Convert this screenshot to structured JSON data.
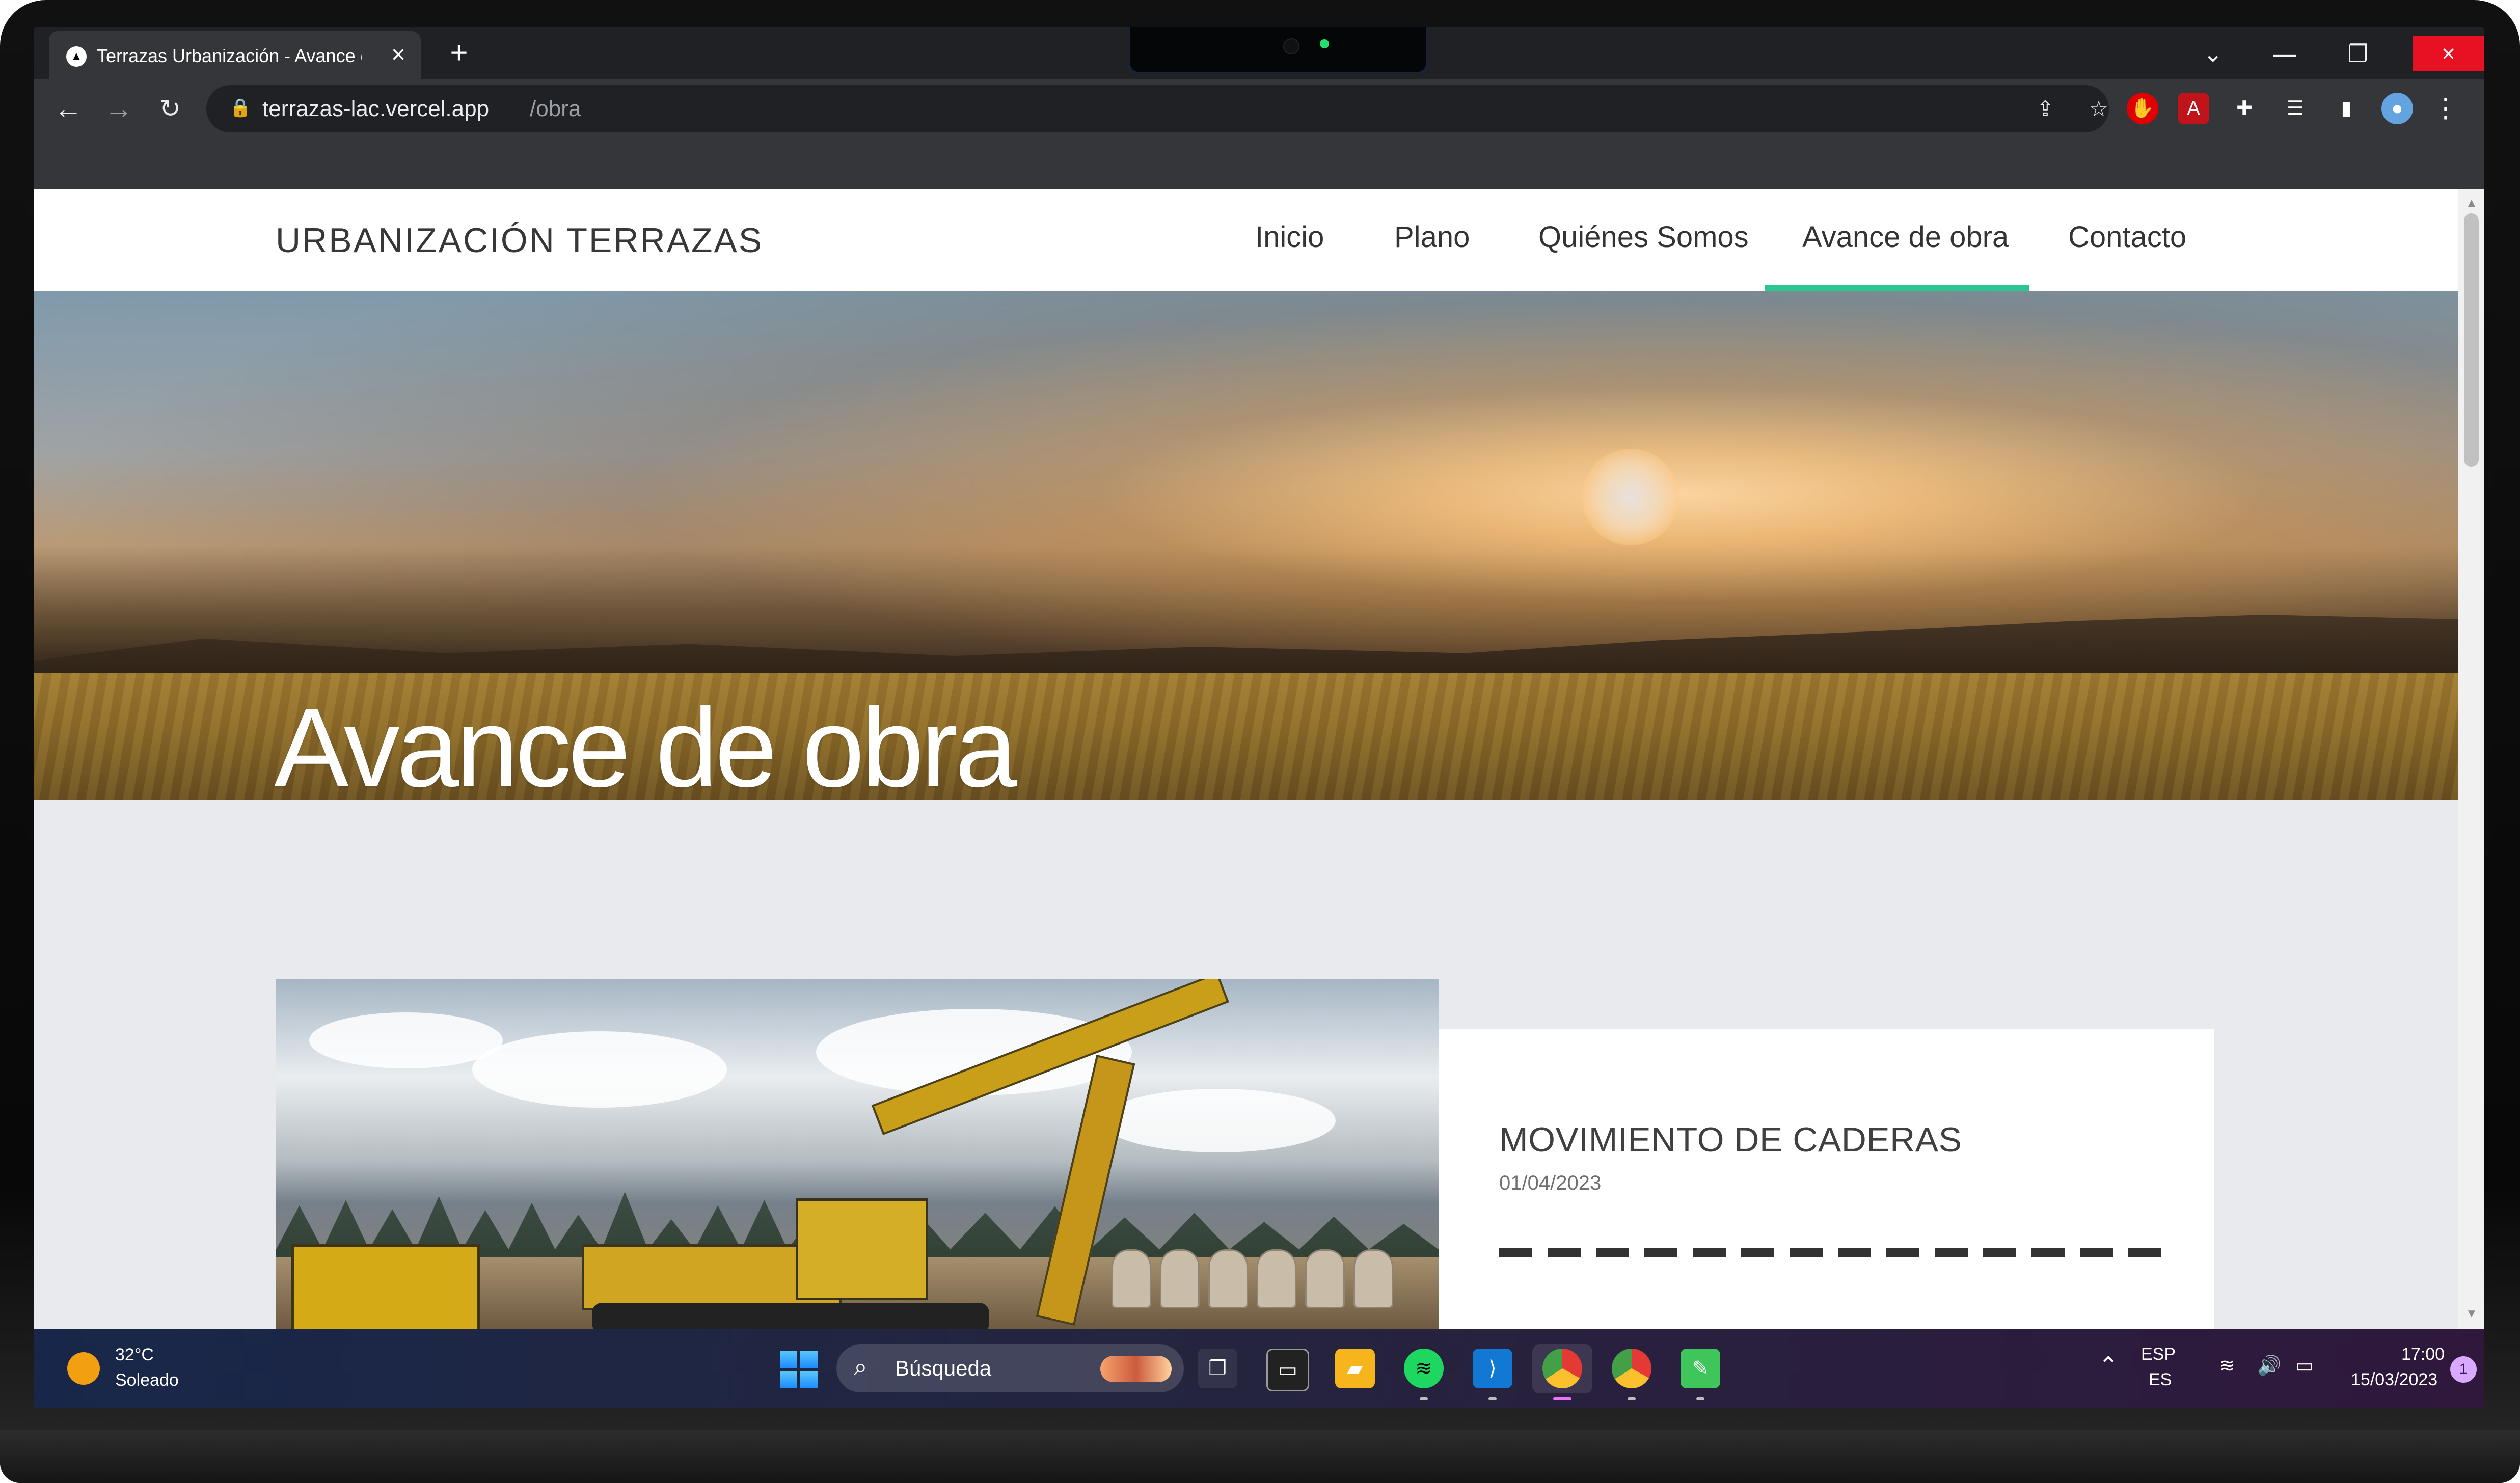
{
  "browser": {
    "tab_title": "Terrazas Urbanización - Avance d",
    "tab_favicon": "▲",
    "tab_close": "×",
    "new_tab": "+",
    "url_domain": "terrazas-lac.vercel.app",
    "url_path": "/obra",
    "icons": {
      "back": "←",
      "forward": "→",
      "reload": "↻",
      "lock": "🔒",
      "share": "⇪",
      "star": "☆",
      "adblock": "✋",
      "pdf": "A",
      "puzzle": "✚",
      "reading_list": "☰",
      "side_panel": "▮",
      "profile": "●",
      "menu": "⋮",
      "tab_search": "⌄",
      "minimize": "—",
      "restore": "❐",
      "close": "×"
    }
  },
  "site": {
    "logo": "URBANIZACIÓN TERRAZAS",
    "nav": [
      {
        "label": "Inicio"
      },
      {
        "label": "Plano"
      },
      {
        "label": "Quiénes Somos"
      },
      {
        "label": "Avance de obra",
        "active": true
      },
      {
        "label": "Contacto"
      }
    ],
    "accent_color": "#2cc690",
    "hero_title": "Avance de obra",
    "post": {
      "title": "MOVIMIENTO DE CADERAS",
      "date": "01/04/2023"
    }
  },
  "taskbar": {
    "weather": {
      "temperature": "32°C",
      "condition": "Soleado"
    },
    "search_label": "Búsqueda",
    "language_top": "ESP",
    "language_bottom": "ES",
    "time": "17:00",
    "date": "15/03/2023",
    "notification_count": "1",
    "icons": {
      "search": "⌕",
      "chevron": "⌃",
      "wifi": "≋",
      "volume": "🔊",
      "battery": "▭",
      "task_view": "❐",
      "terminal": "▭",
      "file_explorer": "▰",
      "spotify": "≋",
      "vscode": "⟩",
      "chrome": "",
      "notes": "✎"
    }
  }
}
